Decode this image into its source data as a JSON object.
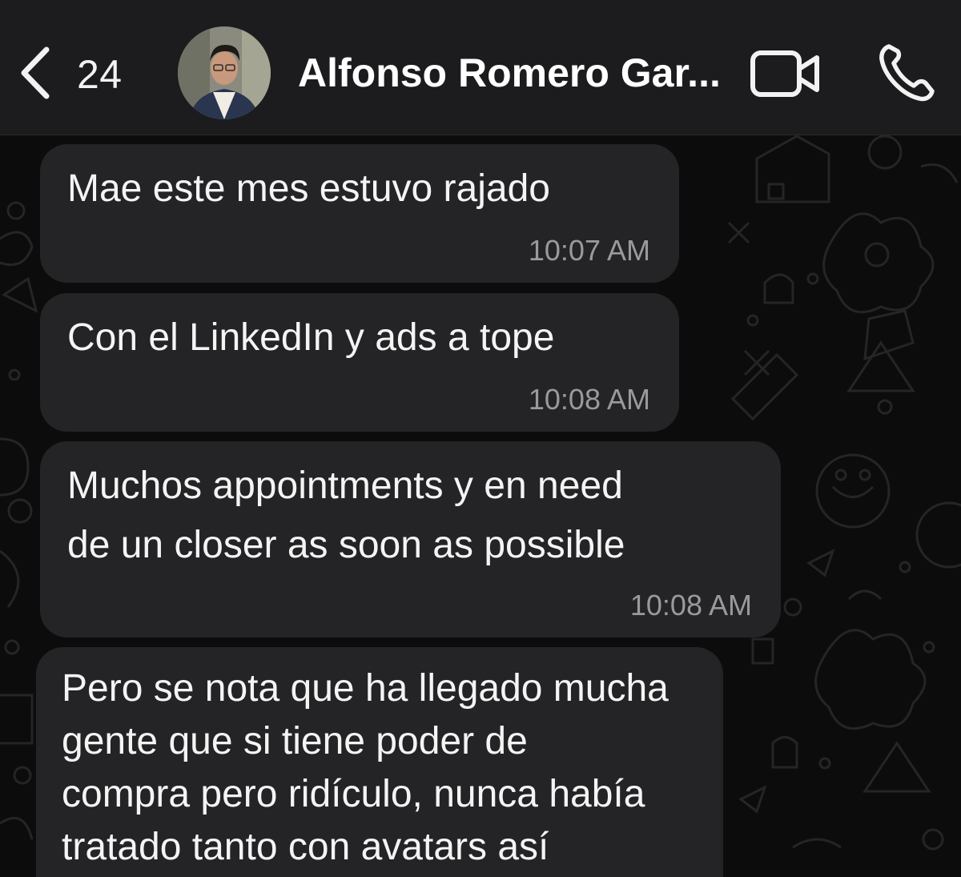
{
  "header": {
    "back_count": "24",
    "contact_name": "Alfonso Romero Gar...",
    "icons": {
      "back": "chevron-left-icon",
      "video": "video-camera-icon",
      "call": "phone-icon"
    }
  },
  "messages": [
    {
      "lines": [
        "Mae este mes estuvo rajado"
      ],
      "time": "10:07 AM"
    },
    {
      "lines": [
        "Con el LinkedIn y ads a tope"
      ],
      "time": "10:08 AM"
    },
    {
      "lines": [
        "Muchos appointments y en need",
        "de un closer as soon as possible"
      ],
      "time": "10:08 AM"
    },
    {
      "lines": [
        "Pero se nota que ha llegado mucha",
        "gente que si tiene poder de",
        "compra pero ridículo, nunca había",
        "tratado tanto con avatars así"
      ],
      "time": ""
    }
  ],
  "colors": {
    "header_bg": "#1c1c1e",
    "bubble_bg": "#242426",
    "chat_bg": "#0c0c0c",
    "timestamp": "#9a9a9c"
  }
}
